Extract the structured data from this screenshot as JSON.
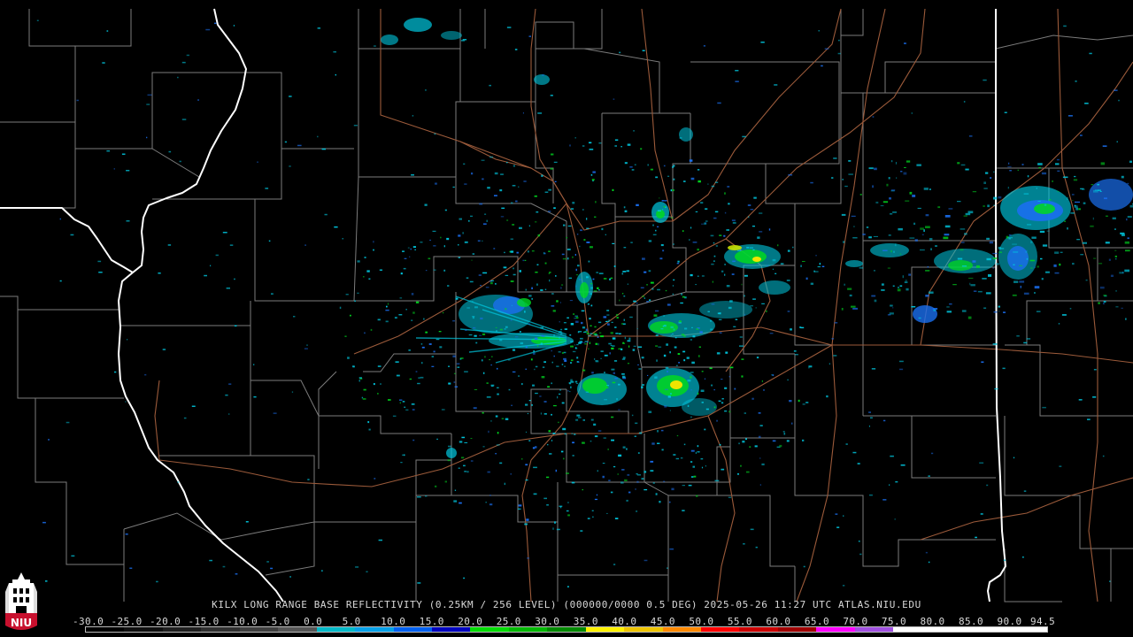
{
  "product": {
    "caption": "KILX LONG RANGE BASE REFLECTIVITY (0.25KM / 256 LEVEL) (000000/0000 0.5 DEG) 2025-05-26 11:27 UTC  ATLAS.NIU.EDU"
  },
  "scale": {
    "labels": [
      "-30.0",
      "-25.0",
      "-20.0",
      "-15.0",
      "-10.0",
      "-5.0",
      "0.0",
      "5.0",
      "10.0",
      "15.0",
      "20.0",
      "25.0",
      "30.0",
      "35.0",
      "40.0",
      "45.0",
      "50.0",
      "55.0",
      "60.0",
      "65.0",
      "70.0",
      "75.0",
      "80.0",
      "85.0",
      "90.0",
      "94.5"
    ],
    "colors": [
      "#000000",
      "#0f0f0f",
      "#1f1f1f",
      "#2f2f2f",
      "#3f3f3f",
      "#555555",
      "#03b9c8",
      "#07a1e8",
      "#0060f0",
      "#0004c0",
      "#02dd04",
      "#03b804",
      "#028a00",
      "#fff200",
      "#eec500",
      "#ff8a00",
      "#ff0000",
      "#cc0000",
      "#a00000",
      "#ff00ff",
      "#a050e0",
      "#ffffff",
      "#ffffff",
      "#ffffff",
      "#ffffff"
    ]
  },
  "colors": {
    "background": "#000000",
    "county_lines": "#8a8a8a",
    "state_lines": "#ffffff",
    "roads": "#9b5a3a",
    "echo_light_cyan": "#00d0e8",
    "echo_blue": "#1060f0",
    "echo_green": "#00e010",
    "echo_yellow": "#f0e400"
  },
  "logo": {
    "text": "NIU",
    "icon": "niu-castle-logo-icon"
  }
}
